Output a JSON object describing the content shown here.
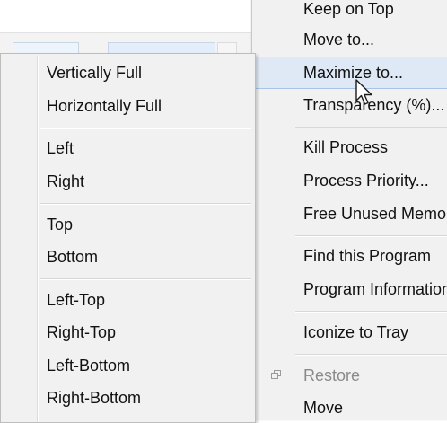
{
  "main_menu": {
    "items": [
      {
        "label": "Keep on Top"
      },
      {
        "label": "Move to..."
      },
      {
        "label": "Maximize to..."
      },
      {
        "label": "Transparency (%)..."
      },
      {
        "label": "Kill Process"
      },
      {
        "label": "Process Priority..."
      },
      {
        "label": "Free Unused Memory"
      },
      {
        "label": "Find this Program"
      },
      {
        "label": "Program Information"
      },
      {
        "label": "Iconize to Tray"
      },
      {
        "label": "Restore"
      },
      {
        "label": "Move"
      }
    ],
    "hovered_item": "Maximize to...",
    "disabled_item": "Restore"
  },
  "submenu": {
    "items": [
      {
        "label": "Vertically Full"
      },
      {
        "label": "Horizontally Full"
      },
      {
        "label": "Left"
      },
      {
        "label": "Right"
      },
      {
        "label": "Top"
      },
      {
        "label": "Bottom"
      },
      {
        "label": "Left-Top"
      },
      {
        "label": "Right-Top"
      },
      {
        "label": "Left-Bottom"
      },
      {
        "label": "Right-Bottom"
      }
    ]
  },
  "icons": {
    "restore": "restore-icon",
    "cursor": "arrow-cursor-icon"
  },
  "colors": {
    "menu_background": "#f1f1f1",
    "hover_background": "#dfe9f5",
    "hover_border": "#a9c4e6",
    "disabled_text": "#8a8a8a"
  }
}
